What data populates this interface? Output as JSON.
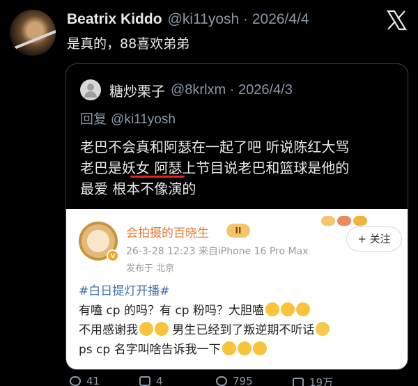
{
  "tweet": {
    "name": "Beatrix Kiddo",
    "handle_date": "@ki11yosh · 2026/4/4",
    "text": "是真的，88喜欢弟弟"
  },
  "quote": {
    "name": "糖炒栗子",
    "handle_date": "@8krlxm · 2026/4/3",
    "reply_label": "回复 ",
    "reply_handle": "@ki11yosh",
    "body_lines": [
      "老巴不会真和阿瑟在一起了吧 听说陈红大骂",
      "老巴是妖女 阿瑟上节目说老巴和篮球是他的",
      "最爱 根本不像演的"
    ]
  },
  "card": {
    "name": "会拍摄的百晓生",
    "level": "II",
    "meta": "26-3-28 12:23  来自iPhone 16 Pro Max",
    "location": "发布于 北京",
    "follow_label": "+ 关注",
    "hashtag": "#白日提灯开播#",
    "line1": "有嗑 cp 的吗？有 cp 粉吗？大胆嗑",
    "line2a": "不用感谢我",
    "line2b": "男生已经到了叛逆期不听话",
    "line3": "ps cp 名字叫啥告诉我一下"
  },
  "actions": {
    "reply_count": "41",
    "retweet_count": "4",
    "like_count": "795",
    "view_count": "19万"
  },
  "colors": {
    "background": "#000000",
    "text": "#e7e9ea",
    "muted": "#8b98a5",
    "card_name": "#ea7a2f",
    "hashtag": "#3e6fb0",
    "underline": "#e0261d"
  }
}
